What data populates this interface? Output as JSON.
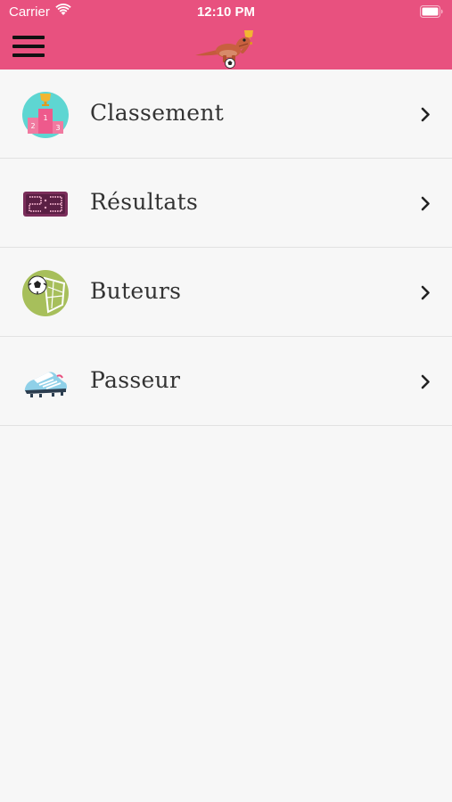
{
  "status_bar": {
    "carrier": "Carrier",
    "time": "12:10 PM"
  },
  "nav_bar": {
    "background_color": "#e8517f",
    "menu_icon": "hamburger-menu-icon",
    "logo_icon": "dinosaur-soccer-logo"
  },
  "menu": {
    "items": [
      {
        "label": "Classement",
        "icon": "podium-trophy-icon"
      },
      {
        "label": "Résultats",
        "icon": "scoreboard-icon"
      },
      {
        "label": "Buteurs",
        "icon": "soccer-goal-icon"
      },
      {
        "label": "Passeur",
        "icon": "soccer-cleat-icon"
      }
    ],
    "chevron_icon": "chevron-right-icon"
  }
}
